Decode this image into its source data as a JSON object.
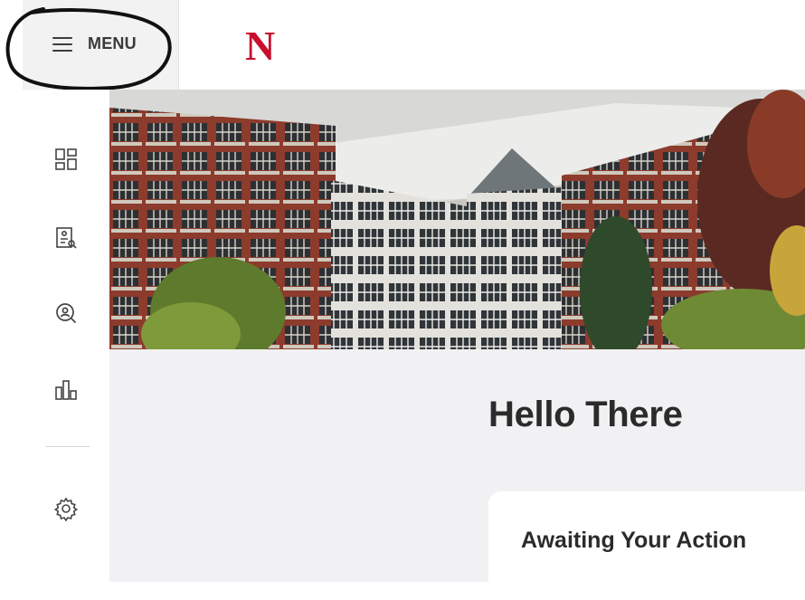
{
  "header": {
    "menu_label": "MENU",
    "logo_text": "N",
    "logo_color": "#c8102e"
  },
  "rail": {
    "items": [
      {
        "icon": "dashboard-icon"
      },
      {
        "icon": "report-search-icon"
      },
      {
        "icon": "search-person-icon"
      },
      {
        "icon": "bar-chart-icon"
      },
      {
        "icon": "gear-icon"
      }
    ]
  },
  "hero": {
    "image": "campus-building-photo"
  },
  "main": {
    "greeting": "Hello There",
    "card": {
      "title": "Awaiting Your Action"
    }
  },
  "colors": {
    "accent": "#c8102e",
    "content_background": "#f1f1f3",
    "brick": "#8a3a2c"
  }
}
